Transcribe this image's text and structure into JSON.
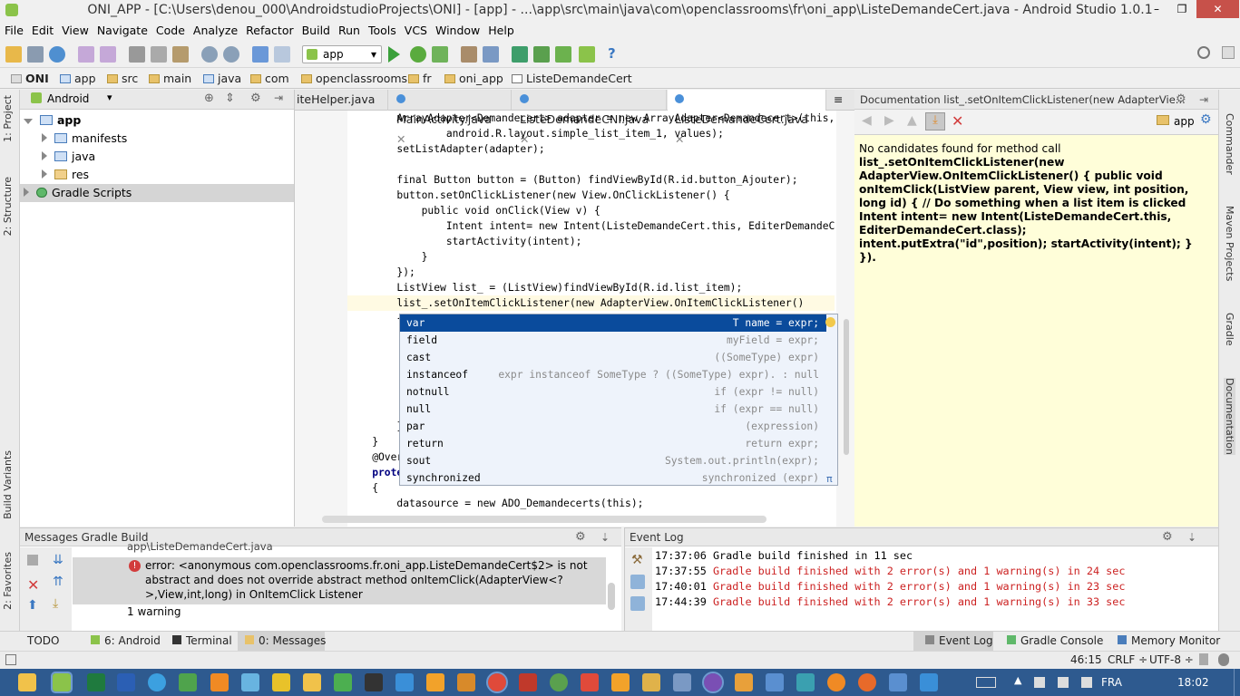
{
  "window": {
    "title": "ONI_APP - [C:\\Users\\denou_000\\AndroidstudioProjects\\ONI] - [app] - ...\\app\\src\\main\\java\\com\\openclassrooms\\fr\\oni_app\\ListeDemandeCert.java - Android Studio 1.0.1",
    "minimize": "–",
    "maximize": "❐",
    "close": "✕"
  },
  "menu": [
    "File",
    "Edit",
    "View",
    "Navigate",
    "Code",
    "Analyze",
    "Refactor",
    "Build",
    "Run",
    "Tools",
    "VCS",
    "Window",
    "Help"
  ],
  "toolbar": {
    "run_config": "app",
    "help": "?"
  },
  "breadcrumb": [
    "ONI",
    "app",
    "src",
    "main",
    "java",
    "com",
    "openclassrooms",
    "fr",
    "oni_app",
    "ListeDemandeCert"
  ],
  "left_strip": {
    "project": "1: Project",
    "structure": "2: Structure",
    "build_variants": "Build Variants",
    "favorites": "2: Favorites"
  },
  "right_strip": {
    "commander": "Commander",
    "maven": "Maven Projects",
    "gradle": "Gradle",
    "documentation": "Documentation"
  },
  "project": {
    "view": "Android",
    "tree": [
      {
        "label": "app",
        "expanded": true
      },
      {
        "label": "manifests"
      },
      {
        "label": "java"
      },
      {
        "label": "res"
      },
      {
        "label": "Gradle Scripts"
      }
    ]
  },
  "editor": {
    "tabs": [
      {
        "label": "iteHelper.java",
        "close": "✕"
      },
      {
        "label": "MainActivity.java",
        "close": "✕"
      },
      {
        "label": "ListeDemandeCNI.java",
        "close": "✕"
      },
      {
        "label": "ListeDemandeCert.java",
        "close": "✕",
        "active": true
      },
      {
        "label": "≡"
      }
    ],
    "lines": [
      "        ArrayAdapter<Demandecert> adapter = new ArrayAdapter<Demandecert>(this,",
      "                android.R.layout.simple_list_item_1, values);",
      "        setListAdapter(adapter);",
      "",
      "        final Button button = (Button) findViewById(R.id.button_Ajouter);",
      "        button.setOnClickListener(new View.OnClickListener() {",
      "            public void onClick(View v) {",
      "                Intent intent= new Intent(ListeDemandeCert.this, EditerDemandeCer",
      "                startActivity(intent);",
      "            }",
      "        });",
      "        ListView list_ = (ListView)findViewById(R.id.list_item);",
      "        list_.setOnItemClickListener(new AdapterView.OnItemClickListener()",
      "        {",
      "",
      "",
      "",
      "",
      "",
      "        });",
      "    }",
      "    @Overrid",
      "    protecte",
      "    {",
      "        datasource = new ADO_Demandecerts(this);"
    ]
  },
  "completion": {
    "items": [
      {
        "name": "var",
        "desc": "T name = expr;"
      },
      {
        "name": "field",
        "desc": "myField = expr;"
      },
      {
        "name": "cast",
        "desc": "((SomeType) expr)"
      },
      {
        "name": "instanceof",
        "desc": "expr instanceof SomeType ? ((SomeType) expr). : null"
      },
      {
        "name": "notnull",
        "desc": "if (expr != null)"
      },
      {
        "name": "null",
        "desc": "if (expr == null)"
      },
      {
        "name": "par",
        "desc": "(expression)"
      },
      {
        "name": "return",
        "desc": "return expr;"
      },
      {
        "name": "sout",
        "desc": "System.out.println(expr);"
      },
      {
        "name": "synchronized",
        "desc": "synchronized (expr)"
      }
    ],
    "pi": "π"
  },
  "documentation": {
    "title": "Documentation list_.setOnItemClickListener(new AdapterVie...",
    "scope": "app",
    "message": "No candidates found for method call",
    "code": "list_.setOnItemClickListener(new AdapterView.OnItemClickListener() { public void onItemClick(ListView parent, View view, int position, long id) { // Do something when a list item is clicked Intent intent= new Intent(ListeDemandeCert.this, EditerDemandeCert.class); intent.putExtra(\"id\",position); startActivity(intent); } })."
  },
  "messages": {
    "title": "Messages Gradle Build",
    "cut_line": "app\\ListeDemandeCert.java",
    "error": "error: <anonymous com.openclassrooms.fr.oni_app.ListeDemandeCert$2> is not abstract and does not override abstract method onItemClick(AdapterView<?>,View,int,long) in OnItemClick Listener",
    "warning": "1 warning"
  },
  "event_log": {
    "title": "Event Log",
    "entries": [
      {
        "time": "17:37:06",
        "text": "Gradle build finished in 11 sec",
        "error": false
      },
      {
        "time": "17:37:55",
        "text": "Gradle build finished with 2 error(s) and 1 warning(s) in 24 sec",
        "error": true
      },
      {
        "time": "17:40:01",
        "text": "Gradle build finished with 2 error(s) and 1 warning(s) in 23 sec",
        "error": true
      },
      {
        "time": "17:44:39",
        "text": "Gradle build finished with 2 error(s) and 1 warning(s) in 33 sec",
        "error": true
      }
    ]
  },
  "bottom_tabs": {
    "todo": "TODO",
    "android": "6: Android",
    "terminal": "Terminal",
    "messages": "0: Messages",
    "event_log": "Event Log",
    "gradle_console": "Gradle Console",
    "memory_monitor": "Memory Monitor"
  },
  "status": {
    "position": "46:15",
    "line_sep": "CRLF ÷",
    "encoding": "UTF-8 ÷"
  },
  "taskbar": {
    "language": "FRA",
    "time": "18:02"
  },
  "colors": {
    "selection": "#0a4b9c",
    "doc_bg": "#fffed9",
    "error_text": "#cc2222",
    "taskbar": "#2e5a8f"
  }
}
